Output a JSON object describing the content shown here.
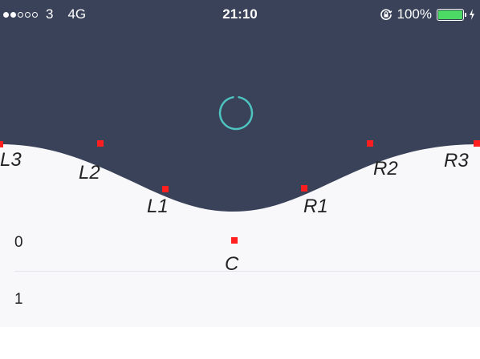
{
  "colors": {
    "header": "#394259",
    "list_background": "#f8f8fb",
    "marker": "#ff1f1f",
    "spinner": "#4ec4c0",
    "battery": "#4cd964"
  },
  "status_bar": {
    "signal_strength": 2,
    "signal_total": 5,
    "carrier": "3",
    "network": "4G",
    "time": "21:10",
    "battery_percent": "100%",
    "battery_level": 1.0,
    "icons": [
      "signal-dots-icon",
      "orientation-lock-icon",
      "battery-icon",
      "charging-bolt-icon"
    ]
  },
  "loader": {
    "icon": "spinner-icon"
  },
  "control_points": [
    {
      "id": "L3",
      "label": "L3"
    },
    {
      "id": "L2",
      "label": "L2"
    },
    {
      "id": "L1",
      "label": "L1"
    },
    {
      "id": "C",
      "label": "C"
    },
    {
      "id": "R1",
      "label": "R1"
    },
    {
      "id": "R2",
      "label": "R2"
    },
    {
      "id": "R3",
      "label": "R3"
    }
  ],
  "list": {
    "rows": [
      {
        "label": "0"
      },
      {
        "label": "1"
      }
    ]
  }
}
